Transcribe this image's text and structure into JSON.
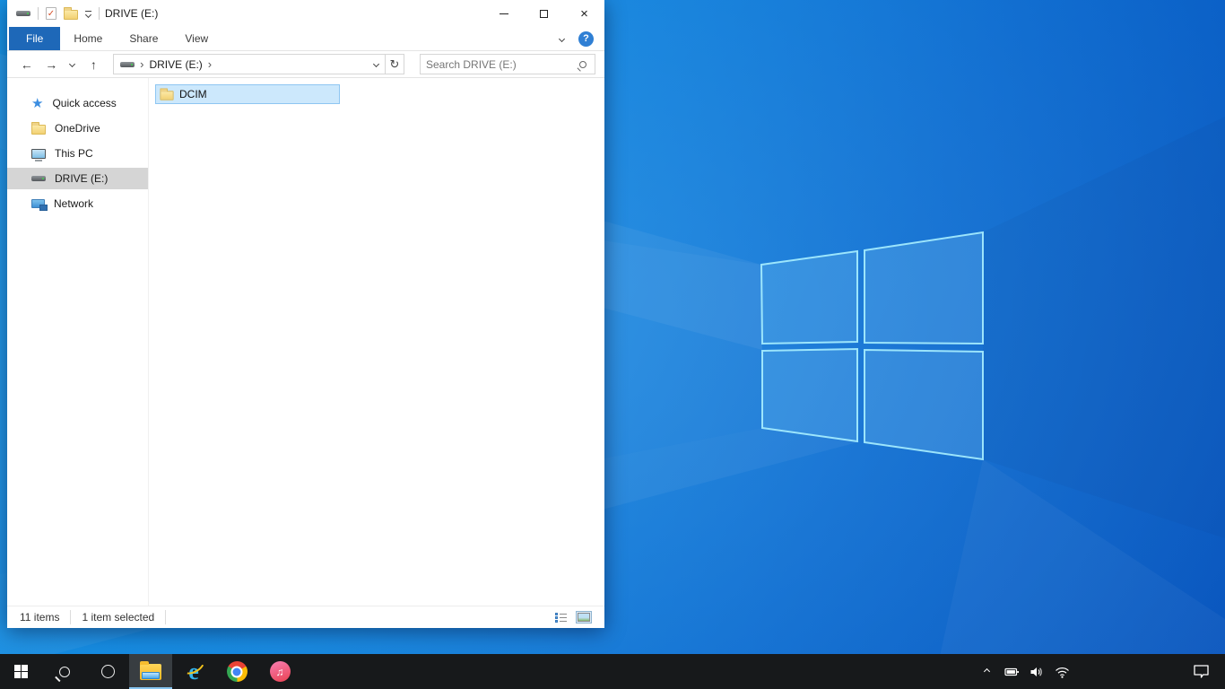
{
  "window": {
    "title": "DRIVE (E:)",
    "controls": {
      "close_glyph": "×"
    }
  },
  "ribbon": {
    "tabs": [
      "File",
      "Home",
      "Share",
      "View"
    ],
    "active_tab": "File",
    "help_glyph": "?"
  },
  "navbar": {
    "back_glyph": "←",
    "forward_glyph": "→",
    "up_glyph": "↑",
    "refresh_glyph": "↻",
    "breadcrumb": {
      "chevron": "›",
      "location": "DRIVE (E:)"
    },
    "search_placeholder": "Search DRIVE (E:)"
  },
  "sidebar": {
    "items": [
      {
        "label": "Quick access",
        "icon": "quick-access-star",
        "star_glyph": "★",
        "selected": false
      },
      {
        "label": "OneDrive",
        "icon": "onedrive-folder",
        "selected": false
      },
      {
        "label": "This PC",
        "icon": "this-pc-monitor",
        "selected": false
      },
      {
        "label": "DRIVE (E:)",
        "icon": "drive",
        "selected": true
      },
      {
        "label": "Network",
        "icon": "network-computer",
        "selected": false
      }
    ]
  },
  "content": {
    "view": "tiles",
    "items": [
      {
        "name": "DCIM",
        "icon": "folder",
        "selected": true
      }
    ]
  },
  "statusbar": {
    "items_count": "11 items",
    "selection": "1 item selected"
  },
  "taskbar": {
    "buttons": [
      {
        "name": "start"
      },
      {
        "name": "search"
      },
      {
        "name": "cortana"
      },
      {
        "name": "file-explorer",
        "active": true
      },
      {
        "name": "internet-explorer",
        "glyph": "e"
      },
      {
        "name": "chrome"
      },
      {
        "name": "itunes",
        "glyph": "♫"
      }
    ],
    "tray": [
      "hidden-icons-chevron",
      "battery",
      "volume",
      "wifi"
    ],
    "action_center": "action-center"
  },
  "colors": {
    "accent_blue": "#0078d7",
    "file_tab_blue": "#1e68b8",
    "selection_fill": "#cce8fc",
    "selection_border": "#8ec6f2",
    "sidebar_selected": "#d5d5d5",
    "taskbar_bg": "#17191b",
    "taskbar_active_underline": "#86c4f0",
    "wallpaper_light": "#0f8fe3",
    "wallpaper_dark": "#0854bd",
    "logo_edge": "#aef4ff",
    "folder_yellow": "#f2d173"
  }
}
